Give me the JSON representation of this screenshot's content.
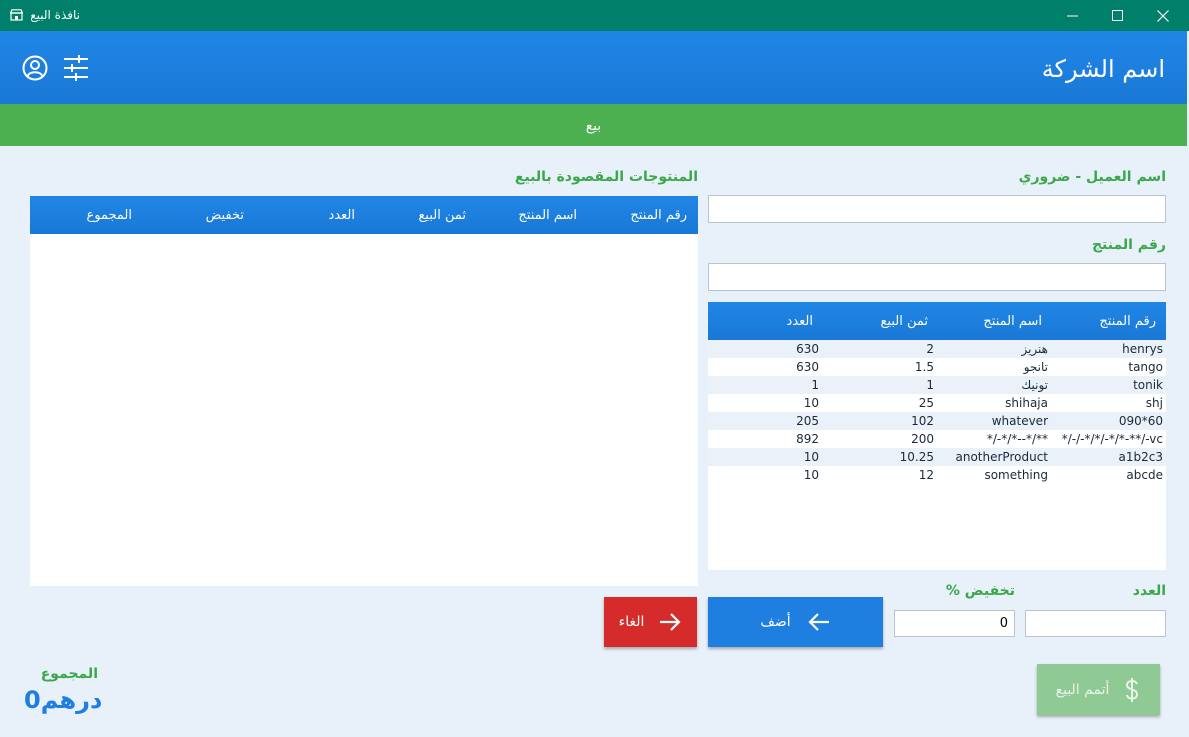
{
  "window": {
    "title": "نافذة البيع",
    "controls": {
      "minimize": "minimize-icon",
      "maximize": "maximize-icon",
      "close": "close-icon"
    }
  },
  "header": {
    "company": "اسم الشركة",
    "icons": [
      "account-circle-icon",
      "settings-sliders-icon"
    ]
  },
  "strip": {
    "label": "بيع"
  },
  "form": {
    "customer_label": "اسم العميل - ضروري",
    "customer_value": "",
    "product_code_label": "رقم المنتج",
    "product_code_value": "",
    "quantity_label": "العدد",
    "quantity_value": "",
    "discount_label": "تخفيض %",
    "discount_value": "0"
  },
  "products": {
    "columns": [
      "رقم المنتج",
      "اسم المنتج",
      "ثمن البيع",
      "العدد"
    ],
    "rows": [
      [
        "henrys",
        "هنريز",
        "2",
        "630"
      ],
      [
        "tango",
        "تانجو",
        "1.5",
        "630"
      ],
      [
        "tonik",
        "تونيك",
        "1",
        "1"
      ],
      [
        "shj",
        "shihaja",
        "25",
        "10"
      ],
      [
        "090*60",
        "whatever",
        "102",
        "205"
      ],
      [
        "*/-/-*/*/-*/*-**/-vc",
        "*/-*/*--*/**",
        "200",
        "892"
      ],
      [
        "a1b2c3",
        "anotherProduct",
        "10.25",
        "10"
      ],
      [
        "abcde",
        "something",
        "12",
        "10"
      ]
    ]
  },
  "cart": {
    "title": "المنتوجات المقصودة بالبيع",
    "columns": [
      "رقم المنتج",
      "اسم المنتج",
      "ثمن البيع",
      "العدد",
      "تخفيض",
      "المجموع"
    ],
    "rows": []
  },
  "buttons": {
    "add": "أضف",
    "cancel": "الغاء",
    "finish": "أتمم البيع"
  },
  "total": {
    "label": "المجموع",
    "amount": "0",
    "currency": "درهم"
  },
  "colors": {
    "titlebar": "#00806a",
    "header": "#1a78d6",
    "strip": "#4caf50",
    "accent_green": "#3aa84a",
    "add_button": "#1f7fe0",
    "cancel_button": "#d52b2b",
    "finish_button_disabled": "#8fc994"
  }
}
